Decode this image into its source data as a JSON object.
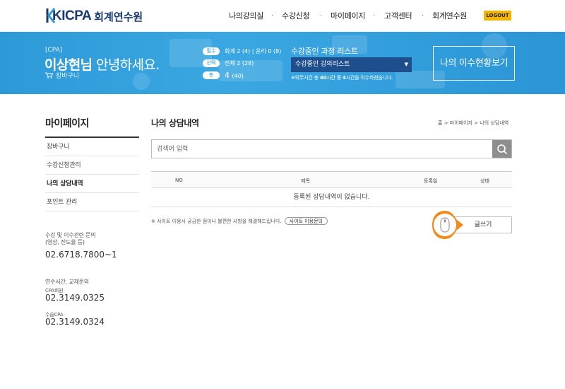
{
  "header": {
    "logo_text": "KICPA",
    "logo_sub": "회계연수원",
    "nav": [
      "나의강의실",
      "수강신청",
      "마이페이지",
      "고객센터",
      "회계연수원"
    ],
    "logout": "LOGOUT"
  },
  "banner": {
    "grade": "[CPA]",
    "user_name": "이상현님",
    "greeting_rest": "안녕하세요.",
    "cart_label": "장바구니",
    "credits": [
      {
        "tag": "필수",
        "text": "회계 2 (4) | 윤리 0 (8)"
      },
      {
        "tag": "선택",
        "text": "전체 2 (28)"
      },
      {
        "tag": "총",
        "value": "4",
        "sub": "(40)"
      }
    ],
    "course_list_title": "수강중인 과정 리스트",
    "course_select_value": "수강중인 강의리스트",
    "course_note_pre": "※의무시간 총 ",
    "course_note_b1": "40",
    "course_note_mid": "시간 중 ",
    "course_note_b2": "4",
    "course_note_post": "시간을 이수하셨습니다.",
    "status_button": "나의 이수현황보기"
  },
  "sidebar": {
    "title": "마이페이지",
    "items": [
      "장바구니",
      "수강신청관리",
      "나의 상담내역",
      "포인트 관리"
    ],
    "active_index": 2,
    "contact1_label": "수강 및 이수관련 문의\n(영상, 진도율 등)",
    "contact1_phone": "02.6718.7800~1",
    "contact2_label": "연수시간, 교재문의",
    "contact2_sub": "CPA회원",
    "contact2_phone": "02.3149.0325",
    "contact3_sub": "수습CPA",
    "contact3_phone": "02.3149.0324"
  },
  "main": {
    "title": "나의 상담내역",
    "breadcrumb": "홈 > 마이페이지 > 나의 상담내역",
    "search_placeholder": "검색어 입력",
    "table_headers": [
      "NO",
      "제목",
      "등록일",
      "상태"
    ],
    "empty_message": "등록된 상담내역이 없습니다.",
    "notice_text": "※ 사이트 이용시 궁금한 점이나 불편한 사항을 해결해드립니다.",
    "notice_button": "사이트 이용문의",
    "write_button": "글쓰기"
  },
  "colors": {
    "banner_blue": "#2d9ad8",
    "select_navy": "#1e4f8c",
    "logout_yellow": "#f2b600",
    "cursor_orange": "#f08a1e"
  },
  "icons": [
    "logo-mark-icon",
    "cart-icon",
    "search-icon",
    "mouse-icon"
  ]
}
